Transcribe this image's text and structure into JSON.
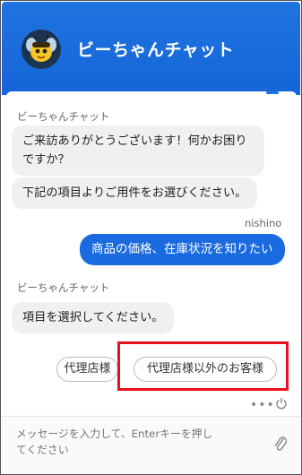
{
  "header": {
    "title": "ビーちゃんチャット",
    "avatar_icon": "bee-icon"
  },
  "messages": [
    {
      "sender": "ビーちゃんチャット",
      "side": "left",
      "bubbles": [
        "ご来訪ありがとうございます！何かお困りですか？",
        "下記の項目よりご用件をお選びください。"
      ]
    },
    {
      "sender": "nishino",
      "side": "right",
      "bubbles": [
        "商品の価格、在庫状況を知りたい"
      ]
    },
    {
      "sender": "ビーちゃんチャット",
      "side": "left",
      "bubbles": [
        "項目を選択してください。"
      ]
    }
  ],
  "choices": [
    {
      "label": "代理店様"
    },
    {
      "label": "代理店様以外のお客様"
    }
  ],
  "composer": {
    "placeholder": "メッセージを入力して、Enterキーを押してください",
    "attach_icon": "paperclip-icon",
    "menu_icon": "more-dots-icon",
    "power_icon": "power-icon"
  },
  "colors": {
    "accent": "#1a6ae0",
    "highlight": "#e8101b"
  }
}
